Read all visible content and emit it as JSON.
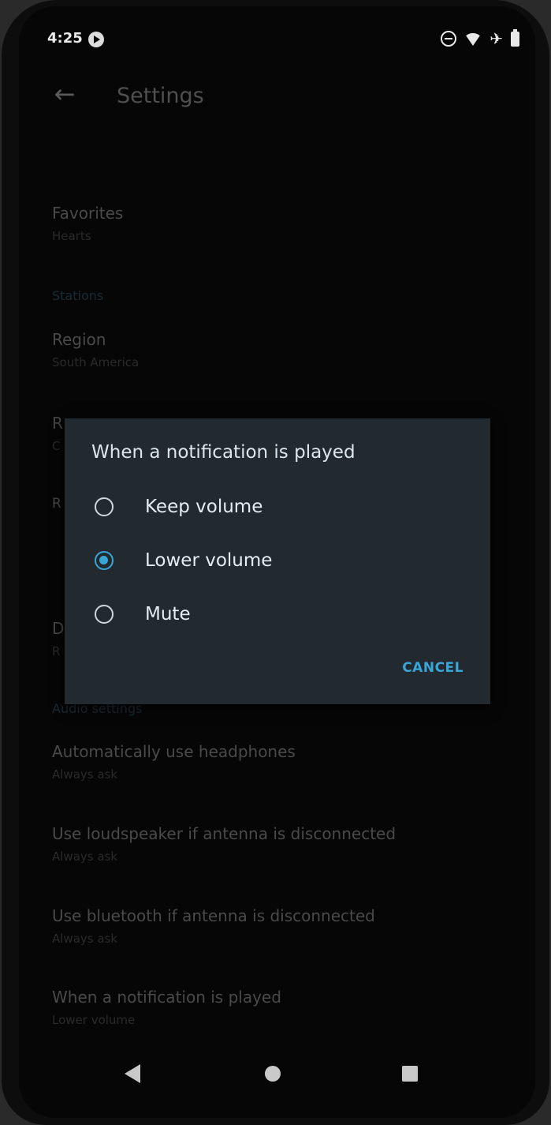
{
  "status_bar": {
    "time": "4:25"
  },
  "app_bar": {
    "title": "Settings"
  },
  "settings": {
    "favorites": {
      "title": "Favorites",
      "subtitle": "Hearts"
    },
    "stations_section": "Stations",
    "region": {
      "title": "Region",
      "subtitle": "South America"
    },
    "partial_1": "R",
    "partial_1_sub": "C",
    "partial_2": "R",
    "partial_3": "D",
    "partial_3_sub": "R",
    "audio_section": "Audio settings",
    "headphones": {
      "title": "Automatically use headphones",
      "subtitle": "Always ask"
    },
    "loudspeaker": {
      "title": "Use loudspeaker if antenna is disconnected",
      "subtitle": "Always ask"
    },
    "bluetooth": {
      "title": "Use bluetooth if antenna is disconnected",
      "subtitle": "Always ask"
    },
    "notification": {
      "title": "When a notification is played",
      "subtitle": "Lower volume"
    }
  },
  "dialog": {
    "title": "When a notification is played",
    "options": [
      {
        "label": "Keep volume",
        "selected": false
      },
      {
        "label": "Lower volume",
        "selected": true
      },
      {
        "label": "Mute",
        "selected": false
      }
    ],
    "cancel_label": "CANCEL"
  },
  "colors": {
    "accent": "#3aa6d8",
    "dialog_bg": "#222a30"
  },
  "icons": {
    "back": "arrow-left-icon",
    "nav_back": "triangle-back-icon",
    "nav_home": "circle-home-icon",
    "nav_recents": "square-recents-icon"
  }
}
